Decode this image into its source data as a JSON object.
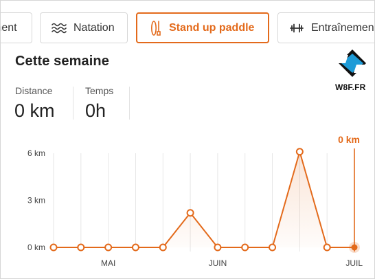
{
  "tabs": [
    {
      "label": "ment",
      "icon": "partial-tab",
      "active": false
    },
    {
      "label": "Natation",
      "icon": "swimming-waves-icon",
      "active": false
    },
    {
      "label": "Stand up paddle",
      "icon": "paddle-board-icon",
      "active": true
    },
    {
      "label": "Entraînement",
      "icon": "dumbbell-icon",
      "active": false
    }
  ],
  "summary": {
    "title": "Cette semaine",
    "distance_label": "Distance",
    "distance_value": "0 km",
    "time_label": "Temps",
    "time_value": "0h"
  },
  "watermark": {
    "text": "W8F.FR",
    "colors": {
      "blue": "#1e9bd7",
      "black": "#111111"
    }
  },
  "colors": {
    "accent": "#e36a1b",
    "grid": "#e6e6e6",
    "axis_text": "#444444"
  },
  "chart_data": {
    "type": "line",
    "title": "",
    "xlabel": "",
    "ylabel": "",
    "ylim": [
      0,
      6
    ],
    "y_ticks": [
      {
        "value": 0,
        "label": "0 km"
      },
      {
        "value": 3,
        "label": "3 km"
      },
      {
        "value": 6,
        "label": "6 km"
      }
    ],
    "x_tick_labels": [
      {
        "index": 2,
        "label": "MAI"
      },
      {
        "index": 6,
        "label": "JUIN"
      },
      {
        "index": 11,
        "label": "JUIL"
      }
    ],
    "series": [
      {
        "values": [
          0,
          0,
          0,
          0,
          0,
          2.2,
          0,
          0,
          0,
          6.1,
          0,
          0
        ]
      }
    ],
    "highlight": {
      "index": 11,
      "label": "0 km"
    },
    "grid": true
  }
}
